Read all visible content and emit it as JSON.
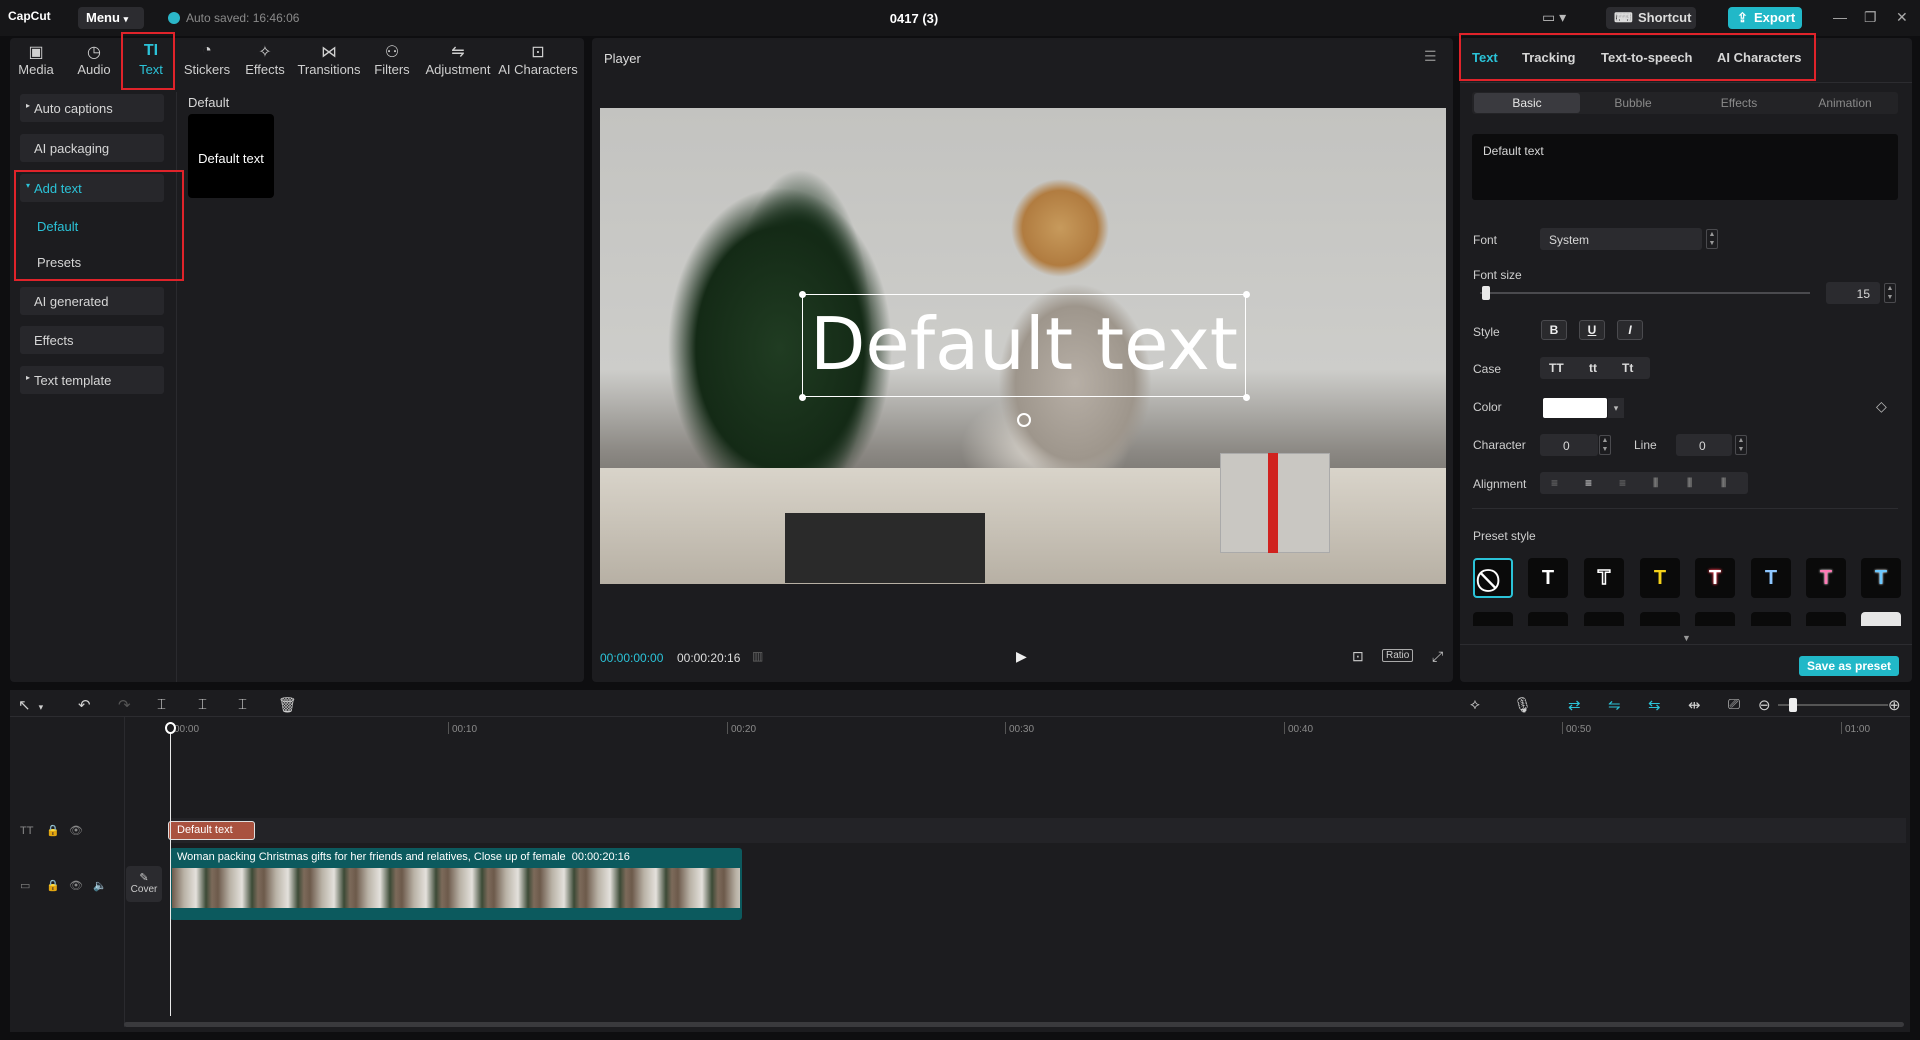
{
  "titlebar": {
    "logo": "CapCut",
    "menu": "Menu",
    "autosave": "Auto saved: 16:46:06",
    "project": "0417 (3)",
    "shortcut": "Shortcut",
    "export": "Export"
  },
  "toolbar": {
    "items": [
      {
        "label": "Media",
        "icon": "media-icon"
      },
      {
        "label": "Audio",
        "icon": "audio-icon"
      },
      {
        "label": "Text",
        "icon": "text-icon"
      },
      {
        "label": "Stickers",
        "icon": "stickers-icon"
      },
      {
        "label": "Effects",
        "icon": "effects-icon"
      },
      {
        "label": "Transitions",
        "icon": "transitions-icon"
      },
      {
        "label": "Filters",
        "icon": "filters-icon"
      },
      {
        "label": "Adjustment",
        "icon": "adjustment-icon"
      },
      {
        "label": "AI Characters",
        "icon": "ai-characters-icon"
      }
    ]
  },
  "sidebar": {
    "auto_captions": "Auto captions",
    "ai_packaging": "AI packaging",
    "add_text": "Add text",
    "default": "Default",
    "presets": "Presets",
    "ai_generated": "AI generated",
    "effects": "Effects",
    "text_template": "Text template"
  },
  "content": {
    "section_title": "Default",
    "card_label": "Default text"
  },
  "player": {
    "title": "Player",
    "overlay_text": "Default text",
    "current_time": "00:00:00:00",
    "duration": "00:00:20:16",
    "ratio": "Ratio"
  },
  "inspector": {
    "tabs": [
      "Text",
      "Tracking",
      "Text-to-speech",
      "AI Characters"
    ],
    "subtabs": [
      "Basic",
      "Bubble",
      "Effects",
      "Animation"
    ],
    "text_value": "Default text",
    "font_label": "Font",
    "font_value": "System",
    "font_size_label": "Font size",
    "font_size_value": "15",
    "style_label": "Style",
    "style_buttons": [
      "B",
      "U",
      "I"
    ],
    "case_label": "Case",
    "case_buttons": [
      "TT",
      "tt",
      "Tt"
    ],
    "color_label": "Color",
    "color_value": "#ffffff",
    "character_label": "Character",
    "character_value": "0",
    "line_label": "Line",
    "line_value": "0",
    "alignment_label": "Alignment",
    "preset_style_label": "Preset style",
    "presets": [
      {
        "glyph": "⃠",
        "color": "#ffffff"
      },
      {
        "glyph": "T",
        "color": "#ffffff"
      },
      {
        "glyph": "T",
        "color": "#ffffff"
      },
      {
        "glyph": "T",
        "color": "#f5d21a"
      },
      {
        "glyph": "T",
        "color": "#ffffff"
      },
      {
        "glyph": "T",
        "color": "#8ec7ff"
      },
      {
        "glyph": "T",
        "color": "#ff7ab6"
      },
      {
        "glyph": "T",
        "color": "#6cc8ff"
      }
    ],
    "save_preset": "Save as preset"
  },
  "timeline": {
    "ruler": [
      "00:00",
      "00:10",
      "00:20",
      "00:30",
      "00:40",
      "00:50",
      "01:00"
    ],
    "text_clip": "Default text",
    "video_clip_title": "Woman packing Christmas gifts for her friends and relatives, Close up of female",
    "video_clip_duration": "00:00:20:16",
    "cover": "Cover"
  }
}
